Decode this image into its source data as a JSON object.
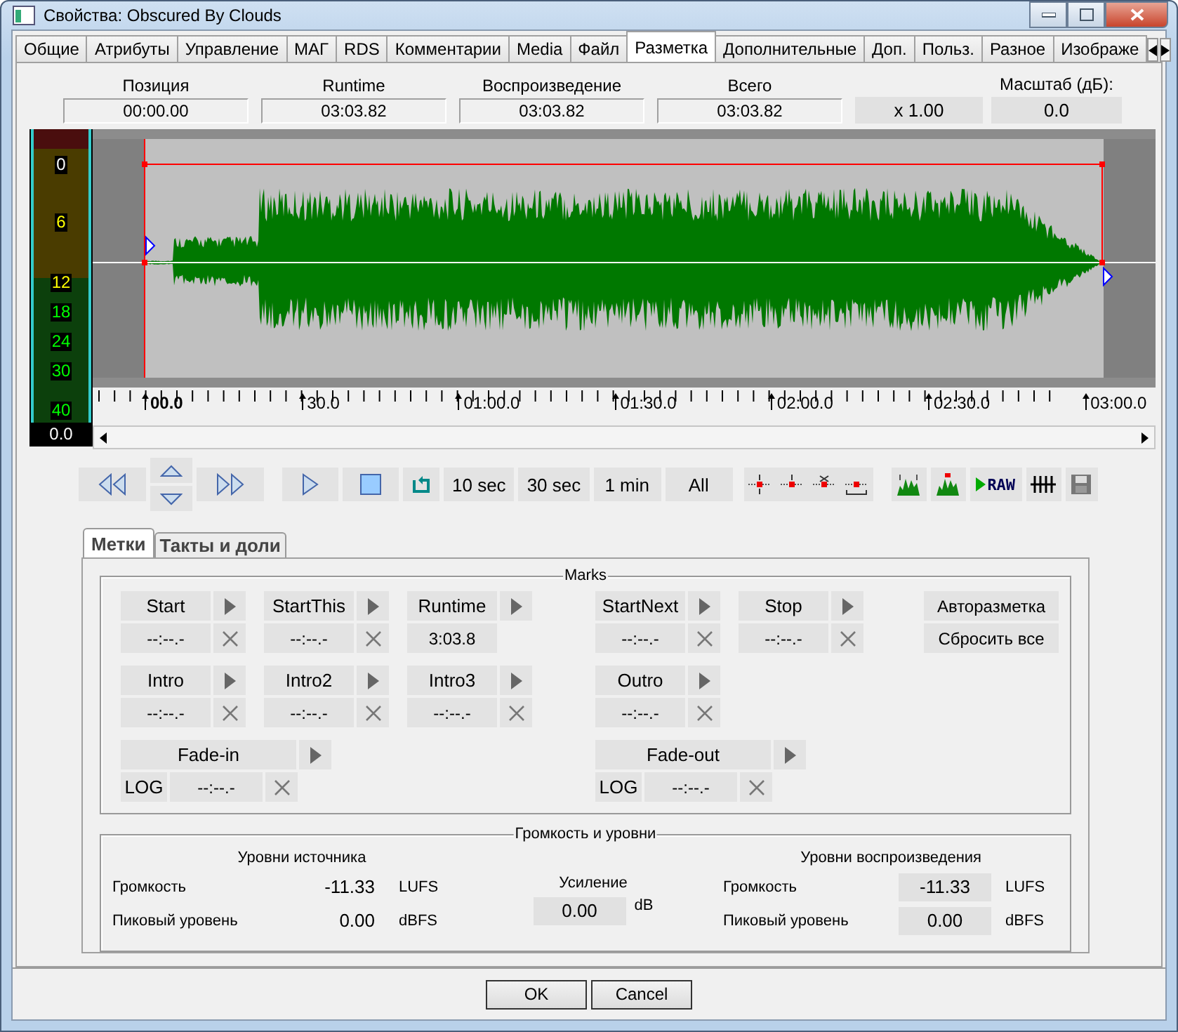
{
  "window": {
    "title": "Свойства: Obscured By Clouds"
  },
  "tabs": [
    {
      "label": "Общие",
      "selected": false
    },
    {
      "label": "Атрибуты",
      "selected": false
    },
    {
      "label": "Управление",
      "selected": false
    },
    {
      "label": "МАГ",
      "selected": false
    },
    {
      "label": "RDS",
      "selected": false
    },
    {
      "label": "Комментарии",
      "selected": false
    },
    {
      "label": "Media",
      "selected": false
    },
    {
      "label": "Файл",
      "selected": false
    },
    {
      "label": "Разметка",
      "selected": true
    },
    {
      "label": "Дополнительные",
      "selected": false
    },
    {
      "label": "Доп.",
      "selected": false
    },
    {
      "label": "Польз.",
      "selected": false
    },
    {
      "label": "Разное",
      "selected": false
    },
    {
      "label": "Изображе",
      "selected": false
    }
  ],
  "info_fields": [
    {
      "label": "Позиция",
      "value": "00:00.00"
    },
    {
      "label": "Runtime",
      "value": "03:03.82"
    },
    {
      "label": "Воспроизведение",
      "value": "03:03.82"
    },
    {
      "label": "Всего",
      "value": "03:03.82"
    }
  ],
  "zoom_factor": "x 1.00",
  "scale": {
    "label": "Масштаб (дБ):",
    "value": "0.0"
  },
  "meter": {
    "ticks": [
      "0",
      "6",
      "12",
      "18",
      "24",
      "30",
      "40"
    ],
    "reading": "0.0"
  },
  "timeline": {
    "labels": [
      "00.0",
      "30.0",
      "01:00.0",
      "01:30.0",
      "02:00.0",
      "02:30.0",
      "03:00.0"
    ]
  },
  "zoom_buttons": [
    "10 sec",
    "30 sec",
    "1 min",
    "All"
  ],
  "raw_button": "RAW",
  "subtabs": [
    {
      "label": "Метки",
      "selected": true
    },
    {
      "label": "Такты и доли",
      "selected": false
    }
  ],
  "marks": {
    "title": "Marks",
    "rows": [
      {
        "left": [
          {
            "kind": "standard",
            "label": "Start",
            "value": "--:--.-"
          },
          {
            "kind": "standard",
            "label": "StartThis",
            "value": "--:--.-"
          },
          {
            "kind": "readonly",
            "label": "Runtime",
            "value": "3:03.8"
          }
        ],
        "right": [
          {
            "kind": "standard",
            "label": "StartNext",
            "value": "--:--.-"
          },
          {
            "kind": "standard",
            "label": "Stop",
            "value": "--:--.-"
          }
        ]
      },
      {
        "left": [
          {
            "kind": "standard",
            "label": "Intro",
            "value": "--:--.-"
          },
          {
            "kind": "standard",
            "label": "Intro2",
            "value": "--:--.-"
          },
          {
            "kind": "standard",
            "label": "Intro3",
            "value": "--:--.-"
          }
        ],
        "right": [
          {
            "kind": "standard",
            "label": "Outro",
            "value": "--:--.-"
          }
        ]
      },
      {
        "left": [
          {
            "kind": "fade",
            "label": "Fade-in",
            "mode": "LOG",
            "value": "--:--.-"
          }
        ],
        "right": [
          {
            "kind": "fade",
            "label": "Fade-out",
            "mode": "LOG",
            "value": "--:--.-"
          }
        ]
      }
    ],
    "actions": [
      "Авторазметка",
      "Сбросить все"
    ]
  },
  "levels": {
    "title": "Громкость и уровни",
    "source": {
      "title": "Уровни источника",
      "rows": [
        {
          "label": "Громкость",
          "value": "-11.33",
          "unit": "LUFS"
        },
        {
          "label": "Пиковый уровень",
          "value": "0.00",
          "unit": "dBFS"
        }
      ]
    },
    "gain": {
      "label": "Усиление",
      "value": "0.00",
      "unit": "dB"
    },
    "playback": {
      "title": "Уровни воспроизведения",
      "rows": [
        {
          "label": "Громкость",
          "value": "-11.33",
          "unit": "LUFS"
        },
        {
          "label": "Пиковый уровень",
          "value": "0.00",
          "unit": "dBFS"
        }
      ]
    }
  },
  "buttons": [
    "OK",
    "Cancel"
  ]
}
